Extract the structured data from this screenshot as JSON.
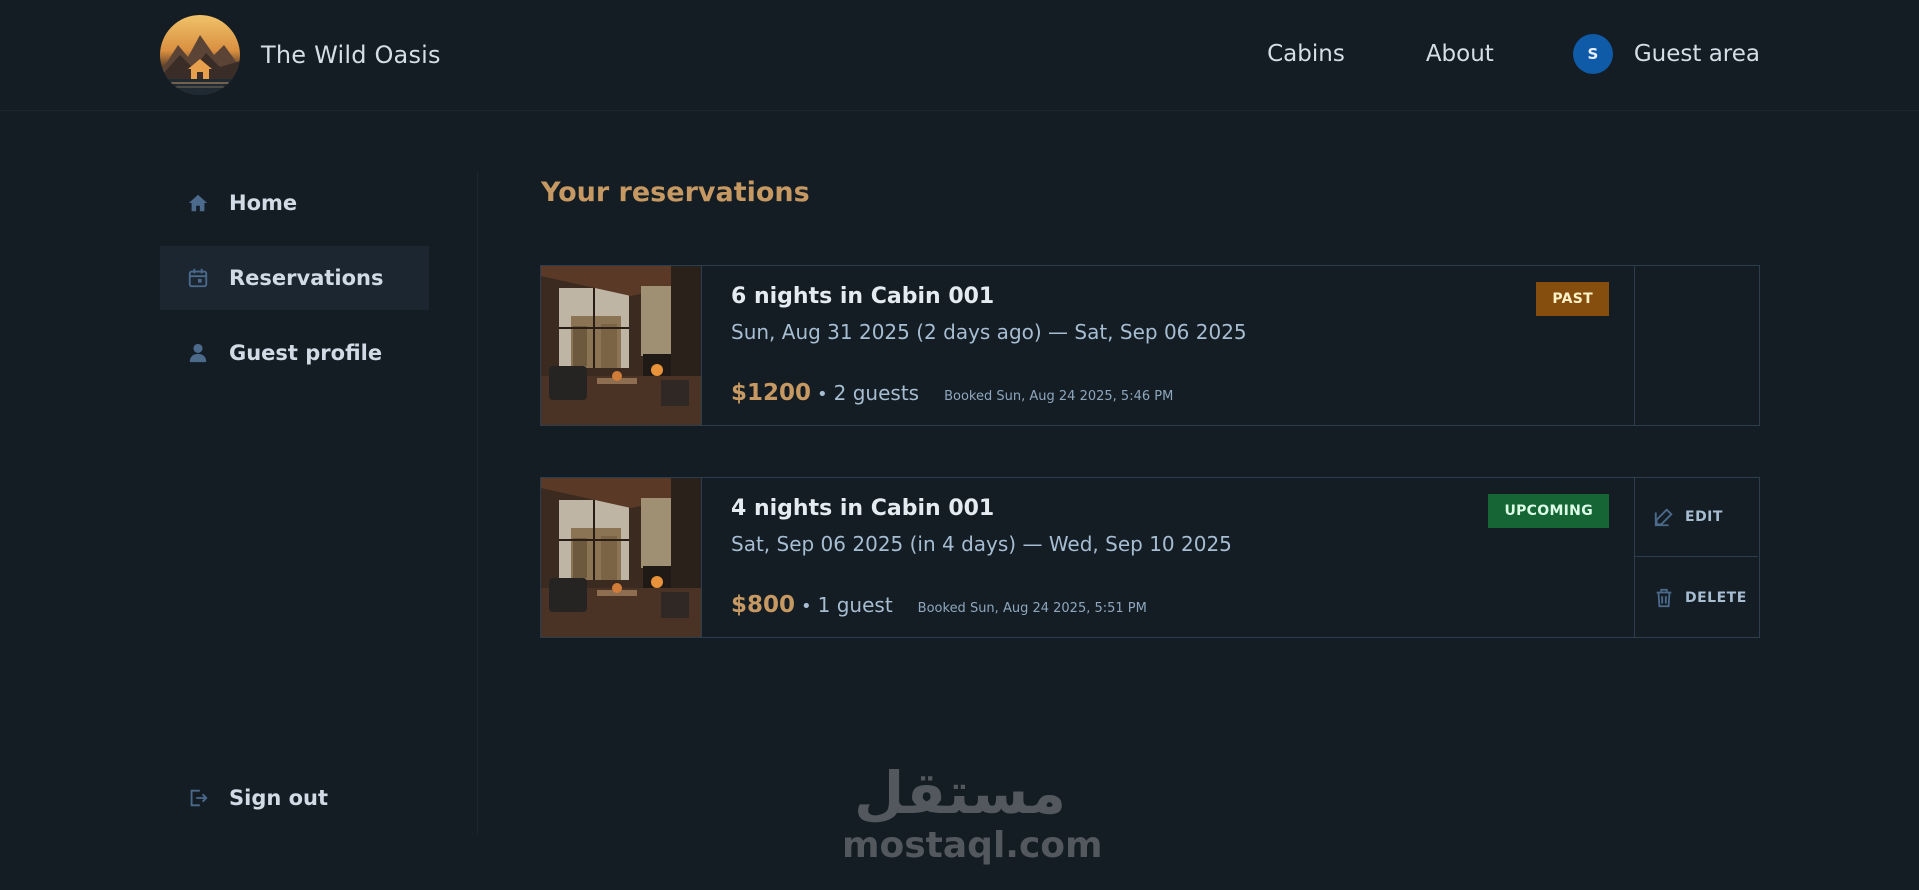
{
  "header": {
    "brand": "The Wild Oasis",
    "nav": {
      "cabins": "Cabins",
      "about": "About",
      "guest_area": "Guest area",
      "avatar_initial": "S"
    }
  },
  "sidebar": {
    "items": [
      {
        "label": "Home",
        "icon": "home-icon"
      },
      {
        "label": "Reservations",
        "icon": "calendar-icon",
        "active": true
      },
      {
        "label": "Guest profile",
        "icon": "user-icon"
      }
    ],
    "sign_out": "Sign out"
  },
  "main": {
    "title": "Your reservations",
    "reservations": [
      {
        "title": "6 nights in Cabin 001",
        "dates": "Sun, Aug 31 2025 (2 days ago) — Sat, Sep 06 2025",
        "price": "$1200",
        "separator": "•",
        "guests": "2 guests",
        "booked": "Booked Sun, Aug 24 2025, 5:46 PM",
        "status": "PAST"
      },
      {
        "title": "4 nights in Cabin 001",
        "dates": "Sat, Sep 06 2025 (in 4 days) — Wed, Sep 10 2025",
        "price": "$800",
        "separator": "•",
        "guests": "1 guest",
        "booked": "Booked Sun, Aug 24 2025, 5:51 PM",
        "status": "UPCOMING",
        "actions": {
          "edit": "EDIT",
          "delete": "DELETE"
        }
      }
    ]
  },
  "watermark": {
    "arabic": "مستقل",
    "latin": "mostaql.com"
  },
  "colors": {
    "background": "#141c24",
    "accent": "#c69963",
    "avatar": "#0f5ba8",
    "past_badge": "#854d0e",
    "upcoming_badge": "#166534"
  }
}
